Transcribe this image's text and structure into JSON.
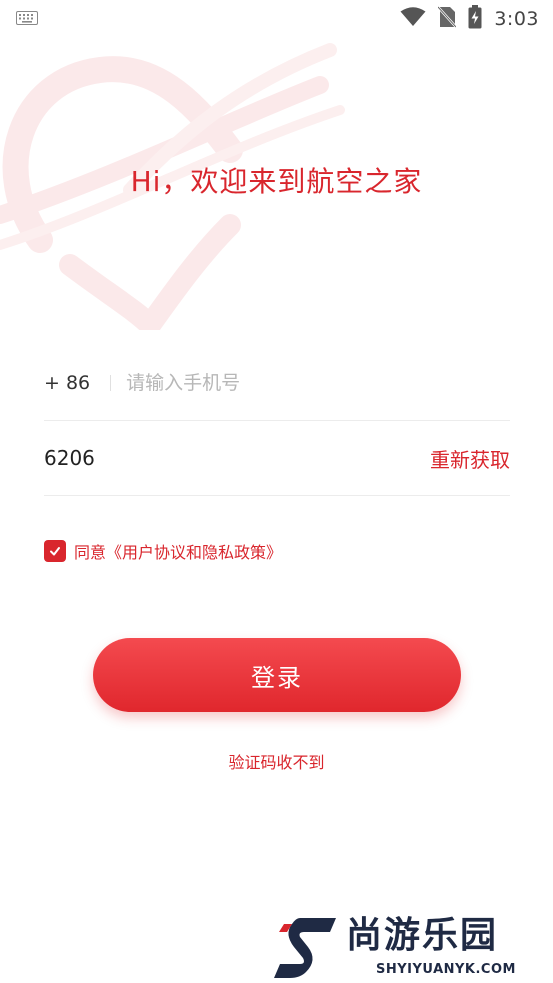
{
  "status_bar": {
    "time": "3:03",
    "icons": [
      "keyboard-icon",
      "wifi-icon",
      "no-sim-icon",
      "battery-charging-icon"
    ]
  },
  "header": {
    "welcome": "Hi，欢迎来到航空之家"
  },
  "form": {
    "country_code": "+ 86",
    "phone_placeholder": "请输入手机号",
    "phone_value": "",
    "code_value": "6206",
    "resend_label": "重新获取",
    "agreement_text": "同意《用户协议和隐私政策》",
    "agreement_checked": true
  },
  "actions": {
    "login_label": "登录",
    "no_code_label": "验证码收不到"
  },
  "watermark": {
    "name": "尚游乐园",
    "url": "SHYIYUANYK.COM"
  },
  "colors": {
    "accent": "#d9262d",
    "background": "#ffffff",
    "watermark": "#1f2a44"
  }
}
